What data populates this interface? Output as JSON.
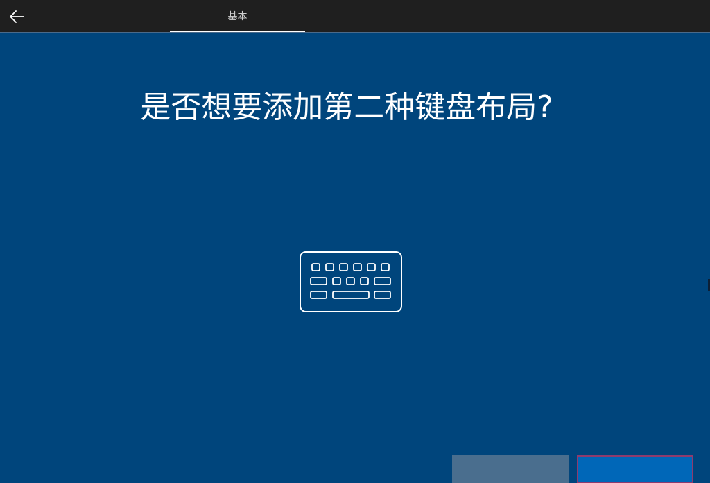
{
  "header": {
    "back_icon": "arrow-left-icon",
    "tab_label": "基本"
  },
  "main": {
    "title": "是否想要添加第二种键盘布局?",
    "illustration_icon": "keyboard-icon"
  },
  "footer": {
    "skip_label": "",
    "primary_label": ""
  },
  "colors": {
    "background": "#00457c",
    "topbar": "#1f1f1f",
    "text": "#ffffff"
  }
}
